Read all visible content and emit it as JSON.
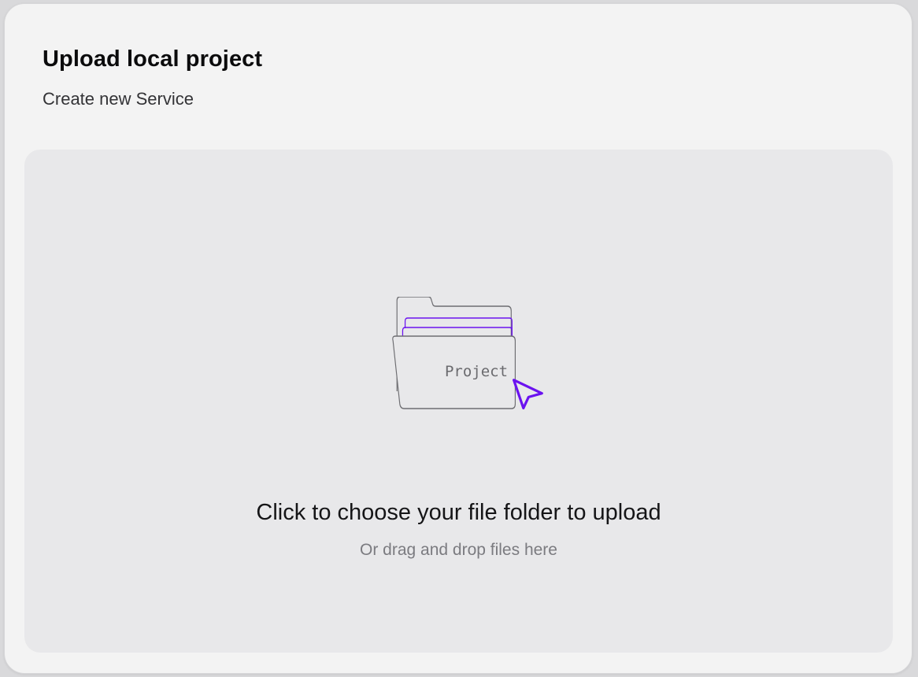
{
  "dialog": {
    "title": "Upload local project",
    "subtitle": "Create new Service"
  },
  "dropzone": {
    "folder_label": "Project",
    "headline": "Click to choose your file folder to upload",
    "hint": "Or drag and drop files here",
    "illustration_icon": "folder-icon",
    "cursor_icon": "cursor-pointer-icon"
  },
  "colors": {
    "accent": "#6b12f0",
    "panel": "#f3f3f3",
    "dropzone": "#e8e8ea",
    "outline": "#6e6e72"
  }
}
